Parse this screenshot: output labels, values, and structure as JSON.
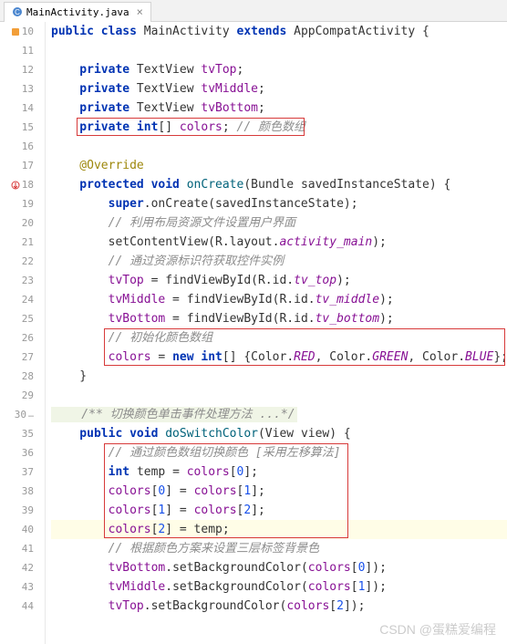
{
  "tab": {
    "filename": "MainActivity.java"
  },
  "gutter": [
    "10",
    "11",
    "12",
    "13",
    "14",
    "15",
    "16",
    "17",
    "18",
    "19",
    "20",
    "21",
    "22",
    "23",
    "24",
    "25",
    "26",
    "27",
    "28",
    "29",
    "30",
    "35",
    "36",
    "37",
    "38",
    "39",
    "40",
    "41",
    "42",
    "43",
    "44"
  ],
  "code": {
    "l10": {
      "pre": "public class ",
      "cls": "MainActivity ",
      "kw2": "extends ",
      "sup": "AppCompatActivity {"
    },
    "l12": {
      "pre": "    private ",
      "ty": "TextView ",
      "fld": "tvTop",
      "end": ";"
    },
    "l13": {
      "pre": "    private ",
      "ty": "TextView ",
      "fld": "tvMiddle",
      "end": ";"
    },
    "l14": {
      "pre": "    private ",
      "ty": "TextView ",
      "fld": "tvBottom",
      "end": ";"
    },
    "l15": {
      "pre": "    private int",
      "arr": "[] ",
      "fld": "colors",
      "end": "; ",
      "cmt": "// 颜色数组"
    },
    "l17": {
      "anno": "    @Override"
    },
    "l18": {
      "pre": "    protected void ",
      "mth": "onCreate",
      "par": "(Bundle savedInstanceState) {"
    },
    "l19": {
      "pre": "        super",
      "dot": ".onCreate(savedInstanceState);"
    },
    "l20": {
      "cmt": "        // 利用布局资源文件设置用户界面"
    },
    "l21": {
      "pre": "        setContentView(R.layout.",
      "id": "activity_main",
      "end": ");"
    },
    "l22": {
      "cmt": "        // 通过资源标识符获取控件实例"
    },
    "l23": {
      "fld": "        tvTop",
      "mid": " = findViewById(R.id.",
      "id": "tv_top",
      "end": ");"
    },
    "l24": {
      "fld": "        tvMiddle",
      "mid": " = findViewById(R.id.",
      "id": "tv_middle",
      "end": ");"
    },
    "l25": {
      "fld": "        tvBottom",
      "mid": " = findViewById(R.id.",
      "id": "tv_bottom",
      "end": ");"
    },
    "l26": {
      "cmt": "        // 初始化颜色数组"
    },
    "l27_a": "        ",
    "l27_fld": "colors",
    "l27_b": " = ",
    "l27_new": "new int",
    "l27_c": "[] {Color.",
    "l27_r": "RED",
    "l27_d": ", Color.",
    "l27_g": "GREEN",
    "l27_e": ", Color.",
    "l27_bl": "BLUE",
    "l27_f": "};",
    "l28": "    }",
    "l30": {
      "doc": "    /** 切换颜色单击事件处理方法 ...*/"
    },
    "l35": {
      "pre": "    public void ",
      "mth": "doSwitchColor",
      "par": "(View view) {"
    },
    "l36": {
      "cmt": "        // 通过颜色数组切换颜色 [采用左移算法]"
    },
    "l37_a": "        ",
    "l37_kw": "int ",
    "l37_b": "temp = ",
    "l37_fld": "colors",
    "l37_c": "[",
    "l37_n": "0",
    "l37_d": "];",
    "l38_a": "        ",
    "l38_fld": "colors",
    "l38_b": "[",
    "l38_n1": "0",
    "l38_c": "] = ",
    "l38_fld2": "colors",
    "l38_d": "[",
    "l38_n2": "1",
    "l38_e": "];",
    "l39_a": "        ",
    "l39_fld": "colors",
    "l39_b": "[",
    "l39_n1": "1",
    "l39_c": "] = ",
    "l39_fld2": "colors",
    "l39_d": "[",
    "l39_n2": "2",
    "l39_e": "];",
    "l40_a": "        ",
    "l40_fld": "colors",
    "l40_b": "[",
    "l40_n": "2",
    "l40_c": "] = temp;",
    "l41": {
      "cmt": "        // 根据颜色方案来设置三层标签背景色"
    },
    "l42_a": "        ",
    "l42_fld": "tvBottom",
    "l42_b": ".setBackgroundColor(",
    "l42_fld2": "colors",
    "l42_c": "[",
    "l42_n": "0",
    "l42_d": "]);",
    "l43_a": "        ",
    "l43_fld": "tvMiddle",
    "l43_b": ".setBackgroundColor(",
    "l43_fld2": "colors",
    "l43_c": "[",
    "l43_n": "1",
    "l43_d": "]);",
    "l44_a": "        ",
    "l44_fld": "tvTop",
    "l44_b": ".setBackgroundColor(",
    "l44_fld2": "colors",
    "l44_c": "[",
    "l44_n": "2",
    "l44_d": "]);"
  },
  "watermark": "CSDN @蛋糕爱编程"
}
